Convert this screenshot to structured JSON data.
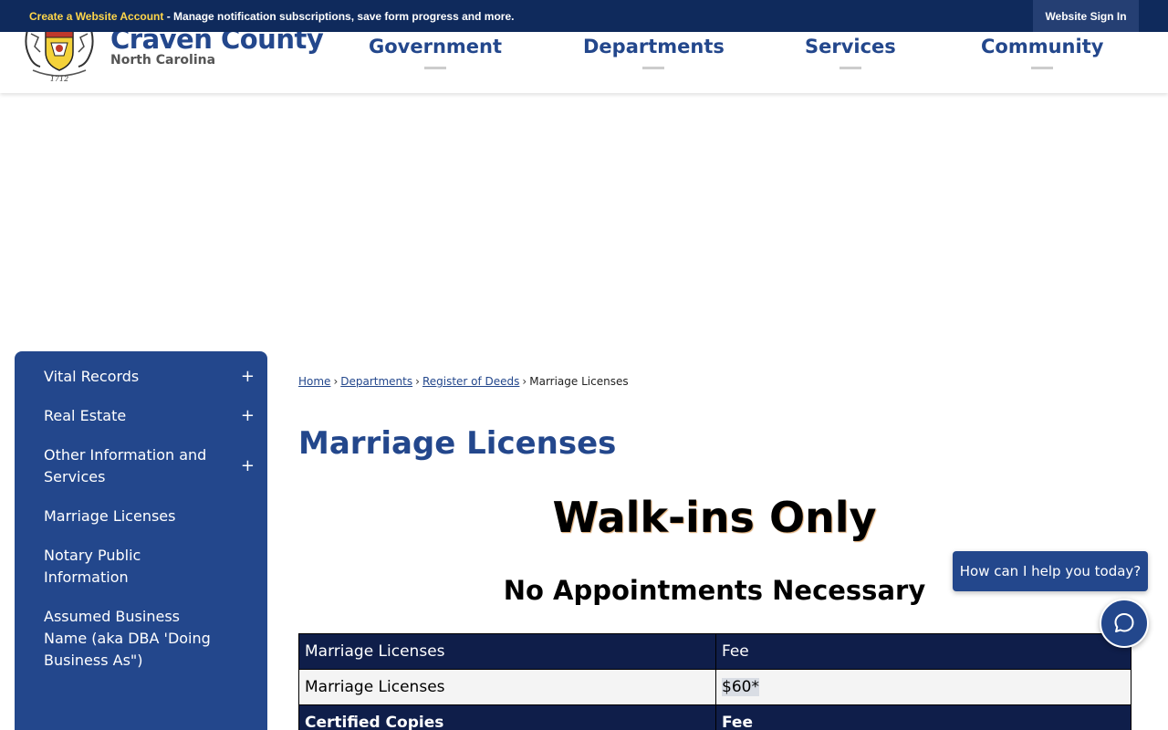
{
  "topbar": {
    "create_link": "Create a Website Account",
    "message": " - Manage notification subscriptions, save form progress and more.",
    "sign_in": "Website Sign In"
  },
  "header": {
    "title": "Craven County",
    "subtitle": "North Carolina",
    "seal_year": "1712",
    "nav": [
      "Government",
      "Departments",
      "Services",
      "Community"
    ]
  },
  "sidebar": {
    "items": [
      {
        "label": "Vital Records",
        "expandable": true,
        "toggle": "+"
      },
      {
        "label": "Real Estate",
        "expandable": true,
        "toggle": "+"
      },
      {
        "label": "Other Information and Services",
        "expandable": true,
        "toggle": "+"
      },
      {
        "label": "Marriage Licenses",
        "expandable": false
      },
      {
        "label": "Notary Public Information",
        "expandable": false
      },
      {
        "label": "Assumed Business Name (aka DBA 'Doing Business As\")",
        "expandable": false
      }
    ]
  },
  "breadcrumb": {
    "items": [
      "Home",
      "Departments",
      "Register of Deeds"
    ],
    "current": "Marriage Licenses",
    "separator": "›"
  },
  "main": {
    "title": "Marriage Licenses",
    "walkins": "Walk-ins Only",
    "no_appointments": "No Appointments Necessary",
    "table": {
      "rows": [
        {
          "type": "head",
          "cells": [
            "Marriage Licenses",
            "Fee"
          ]
        },
        {
          "type": "row",
          "cells": [
            "Marriage Licenses",
            "$60*"
          ]
        },
        {
          "type": "head-bold",
          "cells": [
            "Certified Copies",
            "Fee"
          ]
        }
      ]
    }
  },
  "chat": {
    "prompt": "How can I help you today?",
    "icon": "chat-icon"
  },
  "colors": {
    "brand_blue": "#23478c",
    "topbar_navy": "#0f2a5c",
    "table_header": "#0f1e4a",
    "create_link_yellow": "#ffd64a"
  }
}
